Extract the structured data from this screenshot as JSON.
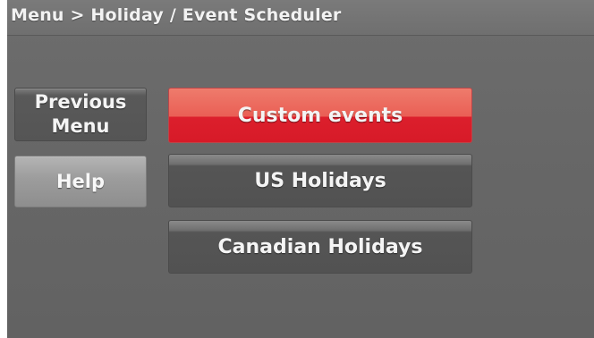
{
  "header": {
    "breadcrumb": "Menu > Holiday / Event Scheduler"
  },
  "sidebar": {
    "previous_menu_line1": "Previous",
    "previous_menu_line2": "Menu",
    "help_label": "Help"
  },
  "options": [
    {
      "label": "Custom events",
      "selected": true
    },
    {
      "label": "US Holidays",
      "selected": false
    },
    {
      "label": "Canadian Holidays",
      "selected": false
    }
  ],
  "colors": {
    "selected_accent": "#d71a28",
    "panel_background": "#676767"
  }
}
